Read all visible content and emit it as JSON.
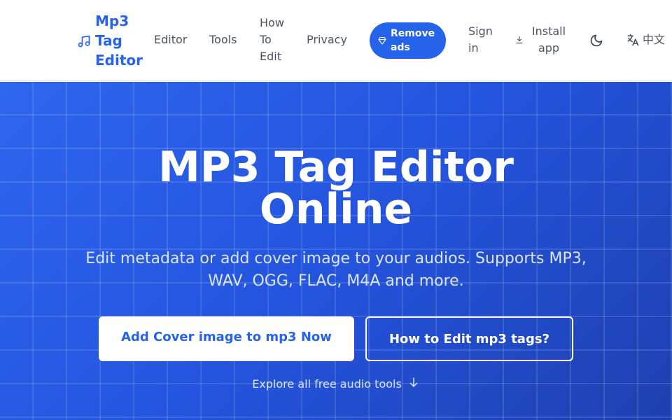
{
  "brand": {
    "name": "Mp3 Tag Editor",
    "icon": "music-note-icon"
  },
  "nav": {
    "editor": "Editor",
    "tools": "Tools",
    "how_to_edit": "How To Edit",
    "privacy": "Privacy",
    "remove_ads": "Remove ads",
    "sign_in": "Sign in",
    "install_app": "Install app",
    "language": "中文"
  },
  "hero": {
    "title": "MP3 Tag Editor Online",
    "subtitle": "Edit metadata or add cover image to your audios. Supports MP3, WAV, OGG, FLAC, M4A and more.",
    "cta_primary": "Add Cover image to mp3 Now",
    "cta_secondary": "How to Edit mp3 tags?",
    "explore": "Explore all free audio tools"
  },
  "colors": {
    "accent": "#2563eb",
    "hero_start": "#2f66ee",
    "hero_end": "#1e40af",
    "nav_text": "#4b5563"
  }
}
